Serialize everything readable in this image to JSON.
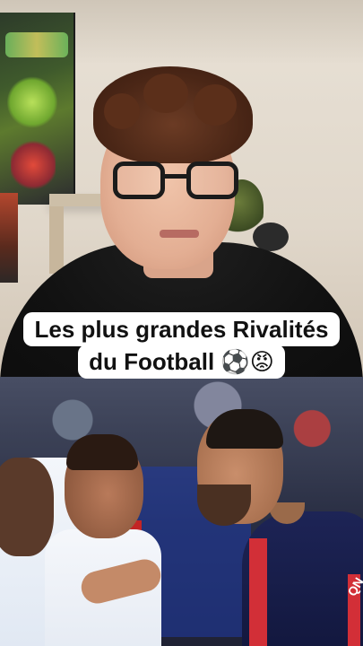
{
  "caption": {
    "line1": "Les plus grandes Rivalités",
    "line2": "du Football",
    "emoji": "⚽😡"
  },
  "bottom_scene": {
    "shirt_text": "QN"
  },
  "colors": {
    "caption_bg": "#ffffff",
    "caption_text": "#111111",
    "psg_navy": "#1d2456",
    "psg_red": "#d22f37"
  }
}
